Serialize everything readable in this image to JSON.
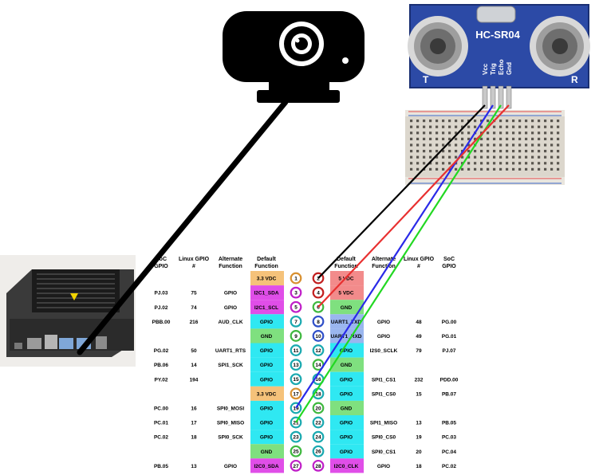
{
  "sensor": {
    "model": "HC-SR04",
    "pins": [
      "Vcc",
      "Trig",
      "Echo",
      "Gnd"
    ],
    "left_mark": "T",
    "right_mark": "R"
  },
  "table": {
    "headers": {
      "left": [
        "SoC GPIO",
        "Linux GPIO #",
        "Alternate Function",
        "Default Function"
      ],
      "right": [
        "Default Function",
        "Alternate Function",
        "Linux GPIO #",
        "SoC GPIO"
      ]
    },
    "rows": [
      {
        "lsoc": "",
        "llinux": "",
        "lalt": "",
        "ldef": "3.3 VDC",
        "lpin": "1",
        "rpin": "2",
        "rdef": "5 VDC",
        "ralt": "",
        "rlinux": "",
        "rsoc": ""
      },
      {
        "lsoc": "PJ.03",
        "llinux": "75",
        "lalt": "GPIO",
        "ldef": "I2C1_SDA",
        "lpin": "3",
        "rpin": "4",
        "rdef": "5 VDC",
        "ralt": "",
        "rlinux": "",
        "rsoc": ""
      },
      {
        "lsoc": "PJ.02",
        "llinux": "74",
        "lalt": "GPIO",
        "ldef": "I2C1_SCL",
        "lpin": "5",
        "rpin": "6",
        "rdef": "GND",
        "ralt": "",
        "rlinux": "",
        "rsoc": ""
      },
      {
        "lsoc": "PBB.00",
        "llinux": "216",
        "lalt": "AUD_CLK",
        "ldef": "GPIO",
        "lpin": "7",
        "rpin": "8",
        "rdef": "UART1_TXD",
        "ralt": "GPIO",
        "rlinux": "48",
        "rsoc": "PG.00"
      },
      {
        "lsoc": "",
        "llinux": "",
        "lalt": "",
        "ldef": "GND",
        "lpin": "9",
        "rpin": "10",
        "rdef": "UART1_RXD",
        "ralt": "GPIO",
        "rlinux": "49",
        "rsoc": "PG.01"
      },
      {
        "lsoc": "PG.02",
        "llinux": "50",
        "lalt": "UART1_RTS",
        "ldef": "GPIO",
        "lpin": "11",
        "rpin": "12",
        "rdef": "GPIO",
        "ralt": "I2S0_SCLK",
        "rlinux": "79",
        "rsoc": "PJ.07"
      },
      {
        "lsoc": "PB.06",
        "llinux": "14",
        "lalt": "SPI1_SCK",
        "ldef": "GPIO",
        "lpin": "13",
        "rpin": "14",
        "rdef": "GND",
        "ralt": "",
        "rlinux": "",
        "rsoc": ""
      },
      {
        "lsoc": "PY.02",
        "llinux": "194",
        "lalt": "",
        "ldef": "GPIO",
        "lpin": "15",
        "rpin": "16",
        "rdef": "GPIO",
        "ralt": "SPI1_CS1",
        "rlinux": "232",
        "rsoc": "PDD.00"
      },
      {
        "lsoc": "",
        "llinux": "",
        "lalt": "",
        "ldef": "3.3 VDC",
        "lpin": "17",
        "rpin": "18",
        "rdef": "GPIO",
        "ralt": "SPI1_CS0",
        "rlinux": "15",
        "rsoc": "PB.07"
      },
      {
        "lsoc": "PC.00",
        "llinux": "16",
        "lalt": "SPI0_MOSI",
        "ldef": "GPIO",
        "lpin": "19",
        "rpin": "20",
        "rdef": "GND",
        "ralt": "",
        "rlinux": "",
        "rsoc": ""
      },
      {
        "lsoc": "PC.01",
        "llinux": "17",
        "lalt": "SPI0_MISO",
        "ldef": "GPIO",
        "lpin": "21",
        "rpin": "22",
        "rdef": "GPIO",
        "ralt": "SPI1_MISO",
        "rlinux": "13",
        "rsoc": "PB.05"
      },
      {
        "lsoc": "PC.02",
        "llinux": "18",
        "lalt": "SPI0_SCK",
        "ldef": "GPIO",
        "lpin": "23",
        "rpin": "24",
        "rdef": "GPIO",
        "ralt": "SPI0_CS0",
        "rlinux": "19",
        "rsoc": "PC.03"
      },
      {
        "lsoc": "",
        "llinux": "",
        "lalt": "",
        "ldef": "GND",
        "lpin": "25",
        "rpin": "26",
        "rdef": "GPIO",
        "ralt": "SPI0_CS1",
        "rlinux": "20",
        "rsoc": "PC.04"
      },
      {
        "lsoc": "PB.05",
        "llinux": "13",
        "lalt": "GPIO",
        "ldef": "I2C0_SDA",
        "lpin": "27",
        "rpin": "28",
        "rdef": "I2C0_CLK",
        "ralt": "GPIO",
        "rlinux": "18",
        "rsoc": "PC.02"
      }
    ]
  },
  "function_colors": {
    "3.3 VDC": "#f5c27a",
    "5 VDC": "#f28b8b",
    "GND": "#7fe07f",
    "GPIO": "#2fe8f2",
    "I2C1_SDA": "#e04ee8",
    "I2C1_SCL": "#e04ee8",
    "I2C0_SDA": "#e04ee8",
    "I2C0_CLK": "#e04ee8",
    "UART1_TXD": "#9ab6ef",
    "UART1_RXD": "#9ab6ef"
  },
  "wires": [
    {
      "from": "Vcc",
      "to_pin": "2",
      "color": "#000000"
    },
    {
      "from": "Trig",
      "to_pin": "19",
      "color": "#2a2ae8"
    },
    {
      "from": "Echo",
      "to_pin": "21",
      "color": "#22d822"
    },
    {
      "from": "Gnd",
      "to_pin": "6",
      "color": "#e83030"
    }
  ],
  "camera": {
    "icon": "webcam-icon"
  },
  "board": {
    "icon": "jetson-nano-board-icon"
  }
}
